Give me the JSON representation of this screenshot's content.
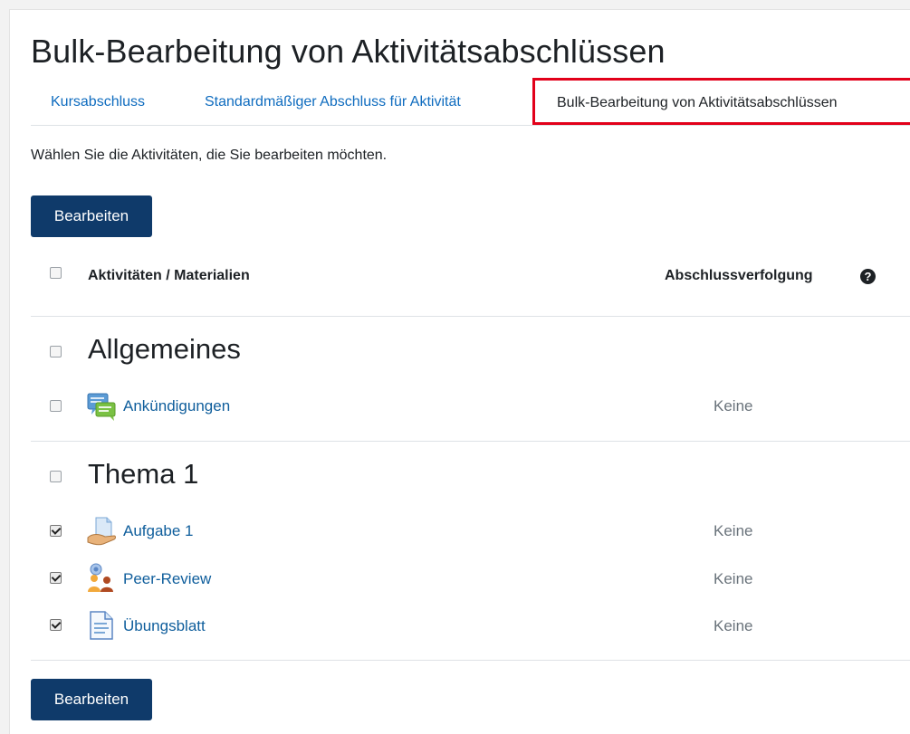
{
  "page": {
    "title": "Bulk-Bearbeitung von Aktivitätsabschlüssen",
    "instruction": "Wählen Sie die Aktivitäten, die Sie bearbeiten möchten."
  },
  "tabs": [
    {
      "label": "Kursabschluss",
      "active": false
    },
    {
      "label": "Standardmäßiger Abschluss für Aktivität",
      "active": false
    },
    {
      "label": "Bulk-Bearbeitung von Aktivitätsabschlüssen",
      "active": true
    }
  ],
  "buttons": {
    "edit_top": "Bearbeiten",
    "edit_bottom": "Bearbeiten"
  },
  "table": {
    "col_activities": "Aktivitäten / Materialien",
    "col_tracking": "Abschlussverfolgung",
    "help_icon": "question-circle-icon"
  },
  "sections": [
    {
      "title": "Allgemeines",
      "checked": false,
      "activities": [
        {
          "name": "Ankündigungen",
          "status": "Keine",
          "checked": false,
          "icon": "forum-icon"
        }
      ]
    },
    {
      "title": "Thema 1",
      "checked": false,
      "activities": [
        {
          "name": "Aufgabe 1",
          "status": "Keine",
          "checked": true,
          "icon": "assignment-icon"
        },
        {
          "name": "Peer-Review",
          "status": "Keine",
          "checked": true,
          "icon": "workshop-icon"
        },
        {
          "name": "Übungsblatt",
          "status": "Keine",
          "checked": true,
          "icon": "page-icon"
        }
      ]
    }
  ],
  "colors": {
    "button_bg": "#0f3a6a",
    "link": "#0f5e9c",
    "highlight": "#e2001a"
  }
}
